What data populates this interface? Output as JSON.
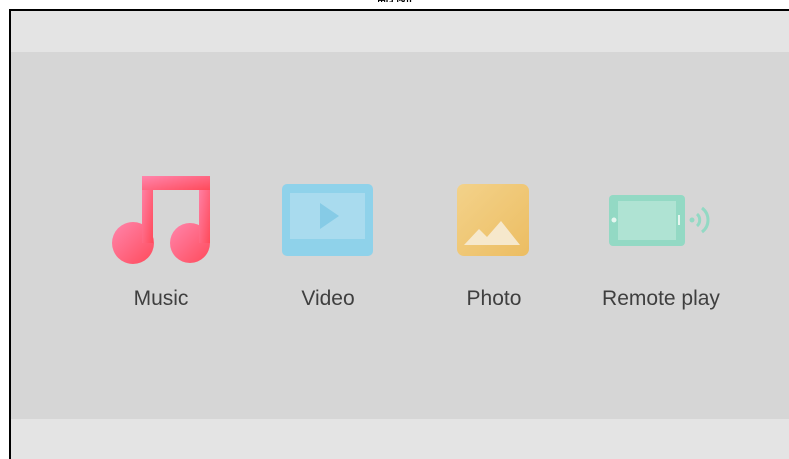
{
  "window": {
    "title": "範例"
  },
  "menu": {
    "items": [
      {
        "id": "music",
        "label": "Music",
        "icon": "music-note-icon",
        "color": "#ff5a6e"
      },
      {
        "id": "video",
        "label": "Video",
        "icon": "video-player-icon",
        "color": "#8fd0ea"
      },
      {
        "id": "photo",
        "label": "Photo",
        "icon": "photo-icon",
        "color": "#f0c773"
      },
      {
        "id": "remote",
        "label": "Remote play",
        "icon": "remote-play-icon",
        "color": "#93d9c4"
      }
    ]
  },
  "colors": {
    "top_bar": "#e4e4e4",
    "content_band": "#d6d6d6",
    "label_text": "#3f3f3f"
  }
}
